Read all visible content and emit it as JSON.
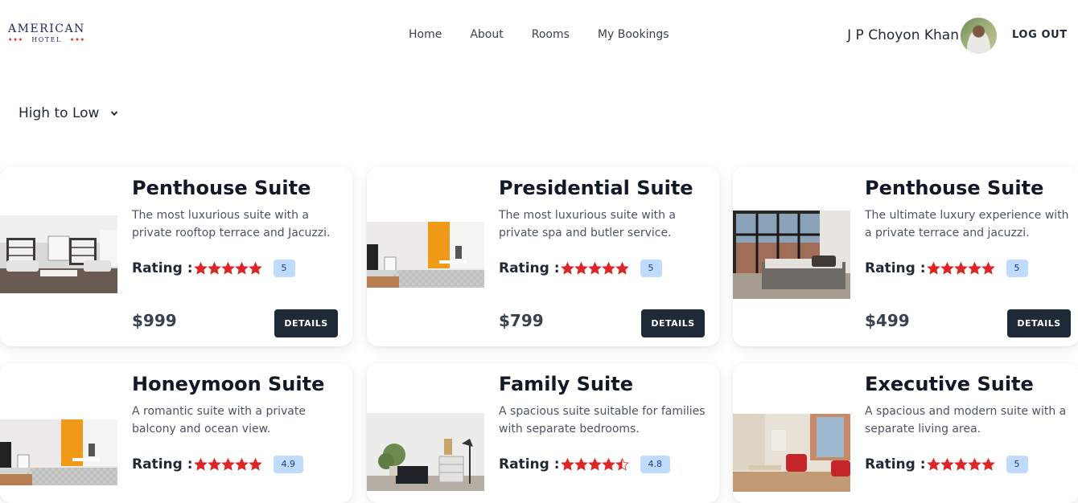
{
  "header": {
    "logo": {
      "main": "AMERICAN",
      "sub": "HOTEL",
      "stars": "★★★"
    },
    "nav": [
      {
        "label": "Home"
      },
      {
        "label": "About"
      },
      {
        "label": "Rooms"
      },
      {
        "label": "My Bookings"
      }
    ],
    "user_name": "J P Choyon Khan",
    "logout_label": "LOG OUT"
  },
  "sort": {
    "selected": "High to Low"
  },
  "rating_label": "Rating :",
  "details_label": "DETAILS",
  "rooms": [
    {
      "title": "Penthouse Suite",
      "description": "The most luxurious suite with a private rooftop terrace and Jacuzzi.",
      "stars": 5,
      "rating": "5",
      "price": "$999",
      "image": "white-living-room"
    },
    {
      "title": "Presidential Suite",
      "description": "The most luxurious suite with a private spa and butler service.",
      "stars": 5,
      "rating": "5",
      "price": "$799",
      "image": "orange-wall-studio"
    },
    {
      "title": "Penthouse Suite",
      "description": "The ultimate luxury experience with a private terrace and jacuzzi.",
      "stars": 5,
      "rating": "5",
      "price": "$499",
      "image": "loft-bedroom"
    },
    {
      "title": "Honeymoon Suite",
      "description": "A romantic suite with a private balcony and ocean view.",
      "stars": 5,
      "rating": "4.9",
      "image": "orange-wall-studio"
    },
    {
      "title": "Family Suite",
      "description": "A spacious suite suitable for families with separate bedrooms.",
      "stars": 4.5,
      "rating": "4.8",
      "image": "minimal-living-room"
    },
    {
      "title": "Executive Suite",
      "description": "A spacious and modern suite with a separate living area.",
      "stars": 5,
      "rating": "5",
      "image": "red-chair-studio"
    }
  ],
  "colors": {
    "star": "#dc2626",
    "badge_bg": "#bfdbfe",
    "button_bg": "#1f2937"
  }
}
